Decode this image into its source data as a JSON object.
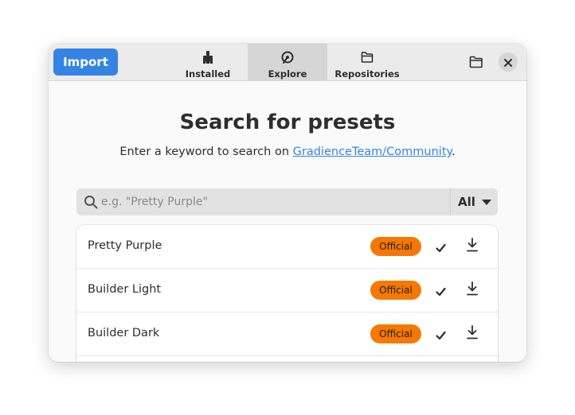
{
  "header": {
    "import_label": "Import",
    "tabs": [
      {
        "label": "Installed",
        "icon": "brush-icon",
        "active": false
      },
      {
        "label": "Explore",
        "icon": "explore-icon",
        "active": true
      },
      {
        "label": "Repositories",
        "icon": "folder-icon",
        "active": false
      }
    ],
    "open_folder_icon": "folder-open-icon",
    "close_icon": "close-icon"
  },
  "main": {
    "title": "Search for presets",
    "subtitle_prefix": "Enter a keyword to search on ",
    "subtitle_link": "GradienceTeam/Community",
    "subtitle_suffix": "."
  },
  "search": {
    "placeholder": "e.g. \"Pretty Purple\"",
    "filter_value": "All"
  },
  "presets": [
    {
      "name": "Pretty Purple",
      "badge": "Official"
    },
    {
      "name": "Builder Light",
      "badge": "Official"
    },
    {
      "name": "Builder Dark",
      "badge": "Official"
    }
  ],
  "colors": {
    "accent": "#3584e4",
    "badge": "#f57900"
  }
}
